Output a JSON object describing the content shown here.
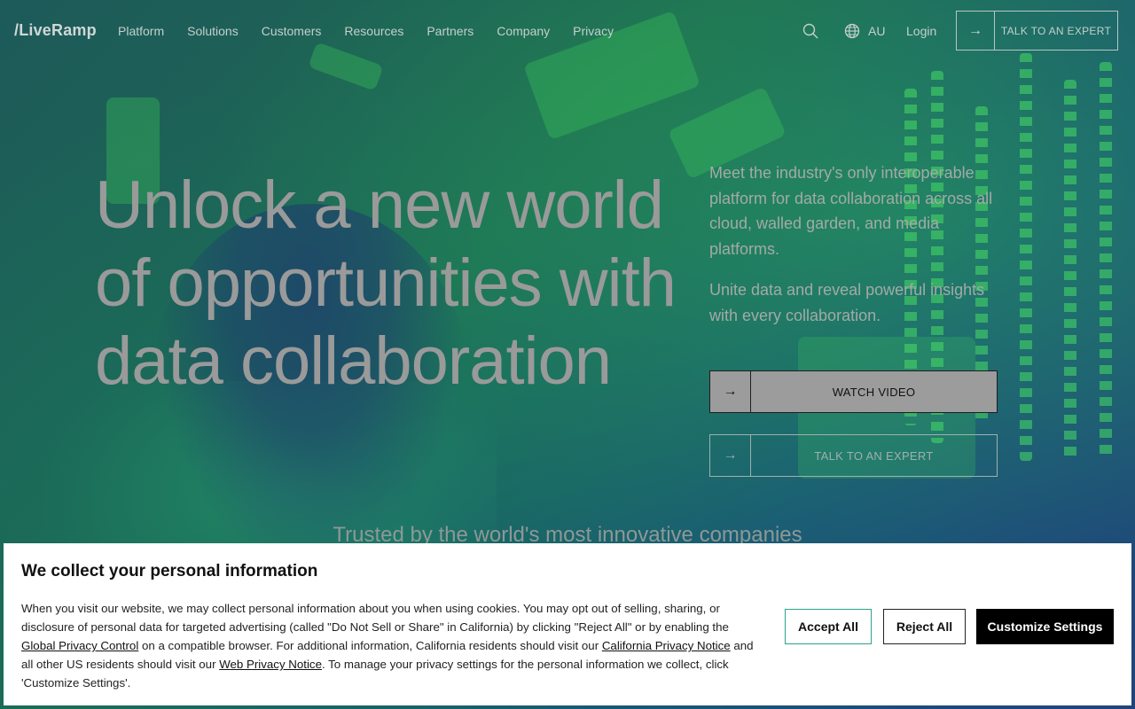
{
  "header": {
    "logo": "/LiveRamp",
    "nav": [
      "Platform",
      "Solutions",
      "Customers",
      "Resources",
      "Partners",
      "Company",
      "Privacy"
    ],
    "region": "AU",
    "login": "Login",
    "cta": "TALK TO AN EXPERT"
  },
  "hero": {
    "headline": "Unlock a new world of opportunities with data collaboration",
    "sub1": "Meet the industry's only interoperable platform for data collaboration across all cloud, walled garden, and media platforms.",
    "sub2": "Unite data and reveal powerful insights with every collaboration.",
    "watch_video": "WATCH VIDEO",
    "talk_expert": "TALK TO AN EXPERT",
    "trusted": "Trusted by the world's most innovative companies"
  },
  "cookie": {
    "title": "We collect your personal information",
    "p1": "When you visit our website, we may collect personal information about you when using cookies. You may opt out of selling, sharing, or disclosure of personal data for targeted advertising (called \"Do Not Sell or Share\" in California) by clicking \"Reject All\" or by enabling the ",
    "link_gpc": "Global Privacy Control",
    "p2": " on a compatible browser. For additional information, California residents should visit our ",
    "link_ca": "California Privacy Notice",
    "p3": " and all other US residents should visit our ",
    "link_web": "Web Privacy Notice",
    "p4": ". To manage your privacy settings for the personal information we collect, click 'Customize Settings'.",
    "accept": "Accept All",
    "reject": "Reject All",
    "customize": "Customize Settings"
  }
}
